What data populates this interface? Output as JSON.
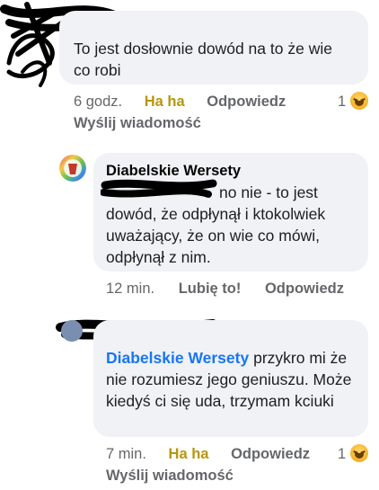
{
  "comment1": {
    "text": "To jest dosłownie dowód na to że wie co robi",
    "time": "6 godz.",
    "reaction_label": "Ha ha",
    "reply_label": "Odpowiedz",
    "reaction_count": "1",
    "send_message": "Wyślij wiadomość"
  },
  "comment2": {
    "author": "Diabelskie Wersety",
    "text": "no nie - to jest dowód, że odpłynął i ktokolwiek uważający, że on wie co mówi, odpłynął z nim.",
    "time": "12 min.",
    "like_label": "Lubię to!",
    "reply_label": "Odpowiedz"
  },
  "comment3": {
    "author_link": "Diabelskie Wersety",
    "text": "przykro mi że nie rozumiesz jego geniuszu. Może kiedyś ci się uda, trzymam kciuki",
    "time": "7 min.",
    "reaction_label": "Ha ha",
    "reply_label": "Odpowiedz",
    "reaction_count": "1",
    "send_message": "Wyślij wiadomość"
  },
  "colors": {
    "bubble": "#f0f2f5",
    "meta": "#65676b",
    "haha": "#b7960d",
    "link": "#1877f2",
    "redaction": "#000000"
  },
  "icons": [
    "haha-emoji-icon",
    "avatar-icon"
  ]
}
